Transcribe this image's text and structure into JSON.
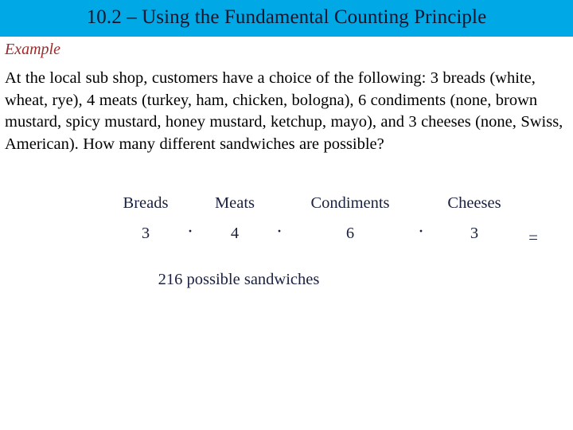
{
  "slide": {
    "title": "10.2 – Using the Fundamental Counting Principle",
    "banner_color": "#00a8e6",
    "title_color": "#12152e",
    "background_color": "#ffffff"
  },
  "example": {
    "label": "Example",
    "label_color": "#a02a2a",
    "problem_text": "At the local sub shop, customers have a choice of the following: 3 breads (white, wheat, rye), 4 meats (turkey, ham, chicken, bologna), 6 condiments (none, brown mustard, spicy mustard, honey mustard, ketchup, mayo), and 3 cheeses (none, Swiss, American). How many different sandwiches are possible?"
  },
  "calculation": {
    "text_color": "#1a2040",
    "headers": [
      "Breads",
      "Meats",
      "Condiments",
      "Cheeses"
    ],
    "values": [
      "3",
      "4",
      "6",
      "3"
    ],
    "operators": [
      "·",
      "·",
      "·"
    ],
    "equals_sign": "=",
    "result_text": "216 possible sandwiches"
  }
}
